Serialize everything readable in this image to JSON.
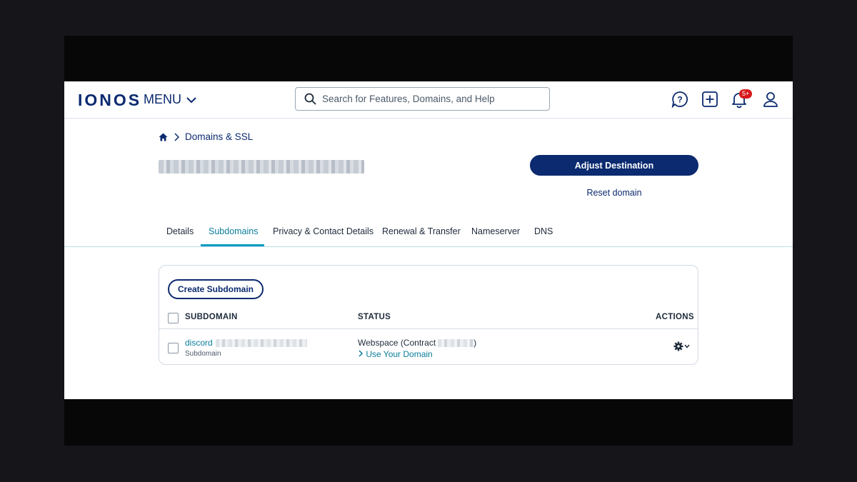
{
  "header": {
    "logo": "IONOS",
    "menu_label": "MENU",
    "search_placeholder": "Search for Features, Domains, and Help",
    "notification_badge": "5+"
  },
  "breadcrumb": {
    "section": "Domains & SSL"
  },
  "domain_actions": {
    "adjust_label": "Adjust Destination",
    "reset_label": "Reset domain"
  },
  "tabs": [
    {
      "label": "Details",
      "active": false
    },
    {
      "label": "Subdomains",
      "active": true
    },
    {
      "label": "Privacy & Contact Details",
      "active": false
    },
    {
      "label": "Renewal & Transfer",
      "active": false
    },
    {
      "label": "Nameserver",
      "active": false
    },
    {
      "label": "DNS",
      "active": false
    }
  ],
  "subdomains": {
    "create_label": "Create Subdomain",
    "columns": {
      "subdomain": "SUBDOMAIN",
      "status": "STATUS",
      "actions": "ACTIONS"
    },
    "rows": [
      {
        "name": "discord",
        "type": "Subdomain",
        "status": "Webspace (Contract",
        "status_suffix": ")",
        "link": "Use Your Domain"
      }
    ]
  },
  "colors": {
    "brand": "#0b2a6f",
    "accent": "#0b9cc2",
    "badge": "#d7191c"
  }
}
